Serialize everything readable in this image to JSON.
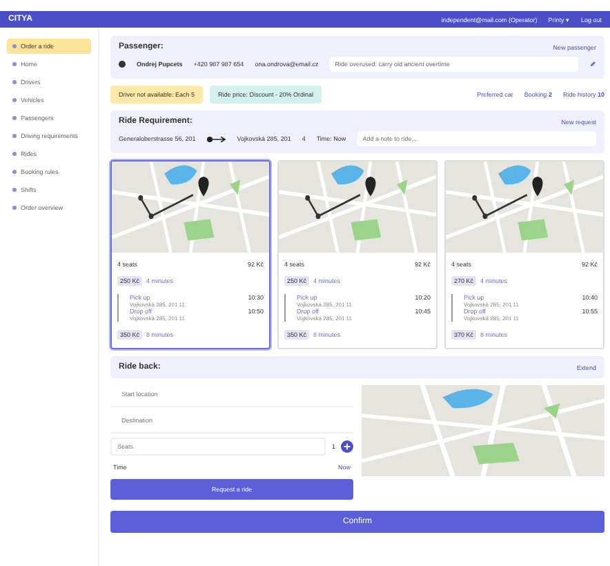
{
  "header": {
    "logo": "CITYA",
    "user": "independent@mail.com (Operator)",
    "language": "Printy ▾",
    "logout": "Log out"
  },
  "sidebar": {
    "items": [
      {
        "label": "Order a ride",
        "selected": true
      },
      {
        "label": "Home",
        "selected": false
      },
      {
        "label": "Drivers",
        "selected": false
      },
      {
        "label": "Vehicles",
        "selected": false
      },
      {
        "label": "Passengers",
        "selected": false
      },
      {
        "label": "Driving requirements",
        "selected": false
      },
      {
        "label": "Rides",
        "selected": false
      },
      {
        "label": "Booking rules",
        "selected": false
      },
      {
        "label": "Shifts",
        "selected": false
      },
      {
        "label": "Order overview",
        "selected": false
      }
    ]
  },
  "passenger": {
    "title": "Passenger:",
    "link": "New passenger",
    "name": "Ondrej Pupcets",
    "phone": "+420 987 987 654",
    "email": "ona.ondrova@email.cz",
    "note": "Ride overused: carry old ancient overtime"
  },
  "alerts": [
    {
      "text": "Driver not available: Each 5",
      "color": "#fde9a8"
    },
    {
      "text": "Ride price: Discount - 20% Ordinal",
      "color": "#d5f1ee"
    }
  ],
  "actions": [
    {
      "label": "Preferred car"
    },
    {
      "label": "Booking",
      "count": "2"
    },
    {
      "label": "Ride history",
      "count": "10"
    }
  ],
  "requirement": {
    "title": "Ride Requirement:",
    "link": "New request",
    "from": "Generaloberstrasse 56, 201",
    "to": "Vojkovská 285, 201",
    "passengers": "4",
    "time": "Time: Now",
    "note_placeholder": "Add a note to ride..."
  },
  "options": [
    {
      "selected": true,
      "seats": "4 seats",
      "price": "92 Kč",
      "wait_price": "250 Kč",
      "wait_time": "4 minutes",
      "pickup": "Pick up",
      "pickup_address": "Vojkovská 285, 201 11",
      "pickup_time": "10:30",
      "dropoff": "Drop off",
      "dropoff_address": "Vojkovská 285, 201 11",
      "dropoff_time": "10:50",
      "total_price": "350 Kč",
      "total_time": "8 minutes"
    },
    {
      "selected": false,
      "seats": "4 seats",
      "price": "92 Kč",
      "wait_price": "250 Kč",
      "wait_time": "4 minutes",
      "pickup": "Pick up",
      "pickup_address": "Vojkovská 285, 201 11",
      "pickup_time": "10:20",
      "dropoff": "Drop off",
      "dropoff_address": "Vojkovská 285, 201 11",
      "dropoff_time": "10:45",
      "total_price": "350 Kč",
      "total_time": "8 minutes"
    },
    {
      "selected": false,
      "seats": "4 seats",
      "price": "92 Kč",
      "wait_price": "270 Kč",
      "wait_time": "4 minutes",
      "pickup": "Pick up",
      "pickup_address": "Vojkovská 285, 201 11",
      "pickup_time": "10:40",
      "dropoff": "Drop off",
      "dropoff_address": "Vojkovská 285, 201 11",
      "dropoff_time": "10:55",
      "total_price": "370 Kč",
      "total_time": "8 minutes"
    }
  ],
  "ride_back": {
    "title": "Ride back:",
    "link": "Extend",
    "start_placeholder": "Start location",
    "destination_placeholder": "Destination",
    "seats_placeholder": "Seats",
    "count": "1",
    "time_label": "Time",
    "time_value": "Now",
    "request_button": "Request a ride"
  },
  "confirm_button": "Confirm"
}
